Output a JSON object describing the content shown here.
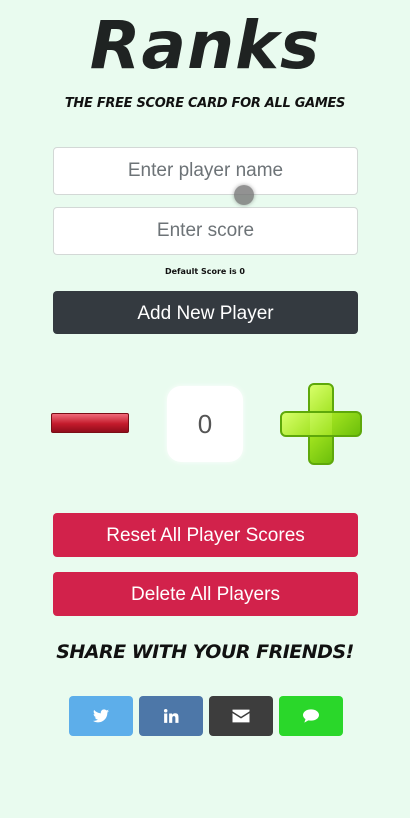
{
  "app": {
    "title": "Ranks",
    "subtitle": "THE FREE SCORE CARD FOR ALL GAMES"
  },
  "form": {
    "name_placeholder": "Enter player name",
    "score_placeholder": "Enter score",
    "default_hint": "Default Score is 0",
    "add_label": "Add New Player"
  },
  "counter": {
    "value": "0"
  },
  "actions": {
    "reset_label": "Reset All Player Scores",
    "delete_label": "Delete All Players"
  },
  "share": {
    "heading": "SHARE WITH YOUR FRIENDS!",
    "buttons": [
      {
        "icon": "twitter-icon",
        "color": "#5daeea"
      },
      {
        "icon": "linkedin-icon",
        "color": "#4d77a8"
      },
      {
        "icon": "email-icon",
        "color": "#3d3d3d"
      },
      {
        "icon": "message-icon",
        "color": "#2ad72a"
      }
    ]
  },
  "colors": {
    "background": "#e9fbef",
    "dark_button": "#343a40",
    "danger": "#d2224b",
    "plus_green": "#9ee11e",
    "minus_red": "#c31a2b"
  }
}
